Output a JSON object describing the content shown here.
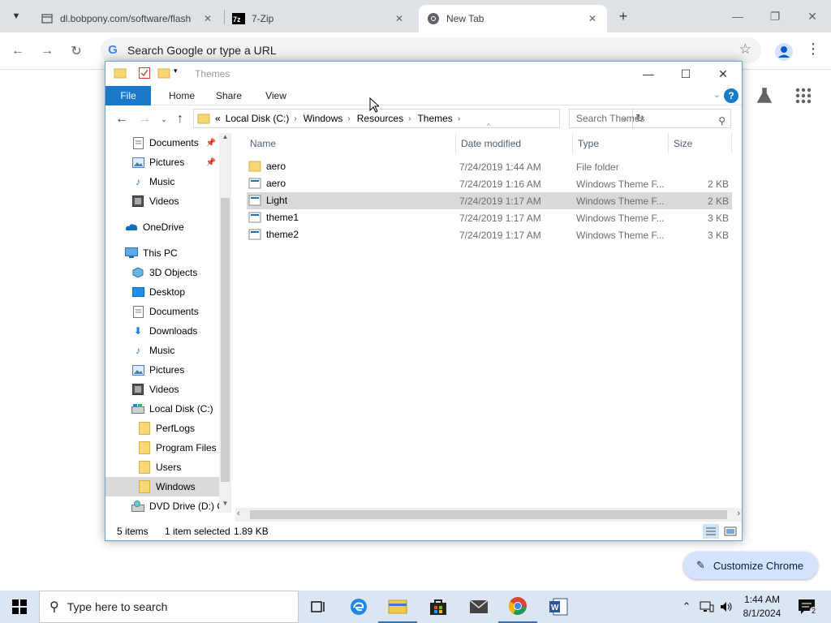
{
  "browser": {
    "tabs": [
      {
        "title": "dl.bobpony.com/software/flash",
        "favicon": "globe-icon",
        "active": false
      },
      {
        "title": "7-Zip",
        "favicon": "7zip-icon",
        "active": false
      },
      {
        "title": "New Tab",
        "favicon": "chrome-icon",
        "active": true
      }
    ],
    "omnibox_placeholder": "Search Google or type a URL",
    "customize_label": "Customize Chrome"
  },
  "explorer": {
    "title": "Themes",
    "ribbon_tabs": [
      "File",
      "Home",
      "Share",
      "View"
    ],
    "breadcrumb": [
      "Local Disk (C:)",
      "Windows",
      "Resources",
      "Themes"
    ],
    "breadcrumb_prefix": "«",
    "search_placeholder": "Search Themes",
    "nav_items": [
      {
        "label": "Documents",
        "icon": "documents-icon",
        "pinned": true
      },
      {
        "label": "Pictures",
        "icon": "pictures-icon",
        "pinned": true
      },
      {
        "label": "Music",
        "icon": "music-icon",
        "pinned": false
      },
      {
        "label": "Videos",
        "icon": "videos-icon",
        "pinned": false
      },
      {
        "label": "OneDrive",
        "icon": "onedrive-icon",
        "pinned": false
      },
      {
        "label": "This PC",
        "icon": "this-pc-icon",
        "pinned": false
      },
      {
        "label": "3D Objects",
        "icon": "3d-objects-icon",
        "pinned": false
      },
      {
        "label": "Desktop",
        "icon": "desktop-icon",
        "pinned": false
      },
      {
        "label": "Documents",
        "icon": "documents-icon",
        "pinned": false
      },
      {
        "label": "Downloads",
        "icon": "downloads-icon",
        "pinned": false
      },
      {
        "label": "Music",
        "icon": "music-icon",
        "pinned": false
      },
      {
        "label": "Pictures",
        "icon": "pictures-icon",
        "pinned": false
      },
      {
        "label": "Videos",
        "icon": "videos-icon",
        "pinned": false
      },
      {
        "label": "Local Disk (C:)",
        "icon": "drive-icon",
        "pinned": false
      },
      {
        "label": "PerfLogs",
        "icon": "folder-icon",
        "pinned": false
      },
      {
        "label": "Program Files",
        "icon": "folder-icon",
        "pinned": false
      },
      {
        "label": "Users",
        "icon": "folder-icon",
        "pinned": false
      },
      {
        "label": "Windows",
        "icon": "folder-icon",
        "pinned": false,
        "selected": true
      },
      {
        "label": "DVD Drive (D:) C",
        "icon": "dvd-drive-icon",
        "pinned": false
      }
    ],
    "columns": [
      "Name",
      "Date modified",
      "Type",
      "Size"
    ],
    "files": [
      {
        "name": "aero",
        "date": "7/24/2019 1:44 AM",
        "type": "File folder",
        "size": "",
        "icon": "folder-icon"
      },
      {
        "name": "aero",
        "date": "7/24/2019 1:16 AM",
        "type": "Windows Theme F...",
        "size": "2 KB",
        "icon": "theme-file-icon"
      },
      {
        "name": "Light",
        "date": "7/24/2019 1:17 AM",
        "type": "Windows Theme F...",
        "size": "2 KB",
        "icon": "theme-file-icon",
        "selected": true
      },
      {
        "name": "theme1",
        "date": "7/24/2019 1:17 AM",
        "type": "Windows Theme F...",
        "size": "3 KB",
        "icon": "theme-file-icon"
      },
      {
        "name": "theme2",
        "date": "7/24/2019 1:17 AM",
        "type": "Windows Theme F...",
        "size": "3 KB",
        "icon": "theme-file-icon"
      }
    ],
    "status": {
      "items": "5 items",
      "selected": "1 item selected",
      "size": "1.89 KB"
    }
  },
  "taskbar": {
    "search_placeholder": "Type here to search",
    "time": "1:44 AM",
    "date": "8/1/2024",
    "notification_count": "2"
  },
  "colors": {
    "accent": "#1979ca",
    "selection": "#d9d9d9",
    "taskbar": "#dce6f3",
    "chrome_tabstrip": "#dee1e6"
  }
}
